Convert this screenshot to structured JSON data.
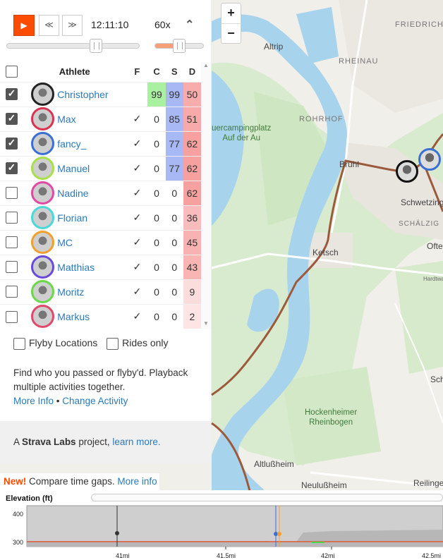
{
  "controls": {
    "time": "12:11:10",
    "speed": "60x",
    "timeline_progress": 0.65,
    "speed_progress": 0.45
  },
  "table": {
    "headers": {
      "athlete": "Athlete",
      "f": "F",
      "c": "C",
      "s": "S",
      "d": "D"
    },
    "rows": [
      {
        "name": "Christopher",
        "checked": true,
        "f": "",
        "c": "99",
        "s": "99",
        "d": "50",
        "ring": "#222222"
      },
      {
        "name": "Max",
        "checked": true,
        "f": "✓",
        "c": "0",
        "s": "85",
        "d": "51",
        "ring": "#d9344f"
      },
      {
        "name": "fancy_",
        "checked": true,
        "f": "✓",
        "c": "0",
        "s": "77",
        "d": "62",
        "ring": "#3b6fd4"
      },
      {
        "name": "Manuel",
        "checked": true,
        "f": "✓",
        "c": "0",
        "s": "77",
        "d": "62",
        "ring": "#a9e04a"
      },
      {
        "name": "Nadine",
        "checked": false,
        "f": "✓",
        "c": "0",
        "s": "0",
        "d": "62",
        "ring": "#e04aa5"
      },
      {
        "name": "Florian",
        "checked": false,
        "f": "✓",
        "c": "0",
        "s": "0",
        "d": "36",
        "ring": "#4ad8d8"
      },
      {
        "name": "MC",
        "checked": false,
        "f": "✓",
        "c": "0",
        "s": "0",
        "d": "45",
        "ring": "#f0a030"
      },
      {
        "name": "Matthias",
        "checked": false,
        "f": "✓",
        "c": "0",
        "s": "0",
        "d": "43",
        "ring": "#6a4ad8"
      },
      {
        "name": "Moritz",
        "checked": false,
        "f": "✓",
        "c": "0",
        "s": "0",
        "d": "9",
        "ring": "#6ad84a"
      },
      {
        "name": "Markus",
        "checked": false,
        "f": "✓",
        "c": "0",
        "s": "0",
        "d": "2",
        "ring": "#e04a6a"
      }
    ]
  },
  "options": {
    "flyby": "Flyby Locations",
    "rides_only": "Rides only"
  },
  "description": {
    "text": "Find who you passed or flyby'd. Playback multiple activities together.",
    "more_info": "More Info",
    "separator": "•",
    "change_activity": "Change Activity"
  },
  "footer": {
    "prefix": "A",
    "brand": "Strava Labs",
    "middle": "project,",
    "link": "learn more."
  },
  "banner": {
    "new": "New!",
    "text": "Compare time gaps.",
    "link": "More info"
  },
  "map": {
    "labels": {
      "friedrichsfeld": "FRIEDRICHS",
      "altrip": "Altrip",
      "rheinau": "RHEINAU",
      "rohrhof": "ROHRHOF",
      "camping": "uercampingplatz\nAuf der Au",
      "bruhl": "Brühl",
      "schwetzingen": "Schwetzing",
      "schalzig": "SCHÄLZIG",
      "ketsch": "Ketsch",
      "ofte": "Ofte",
      "hardtwa": "Hardtwa",
      "hockenheimer": "Hockenheimer\nRheinbogen",
      "altlussheim": "Altlußheim",
      "neulussheim": "Neulußheim",
      "reilingen": "Reilingen",
      "sch": "Sch"
    },
    "zoom_in": "+",
    "zoom_out": "−"
  },
  "elevation": {
    "title": "Elevation (ft)",
    "y_ticks": [
      "400",
      "300"
    ],
    "x_ticks": [
      "41mi",
      "41.5mi",
      "42mi",
      "42.5mi"
    ]
  },
  "colors": {
    "accent": "#fc4c02",
    "link": "#2a7ab8",
    "c_column": "#a9f0a0",
    "s_column": "#a7b8f5",
    "d_column": "#f7b9b9"
  }
}
